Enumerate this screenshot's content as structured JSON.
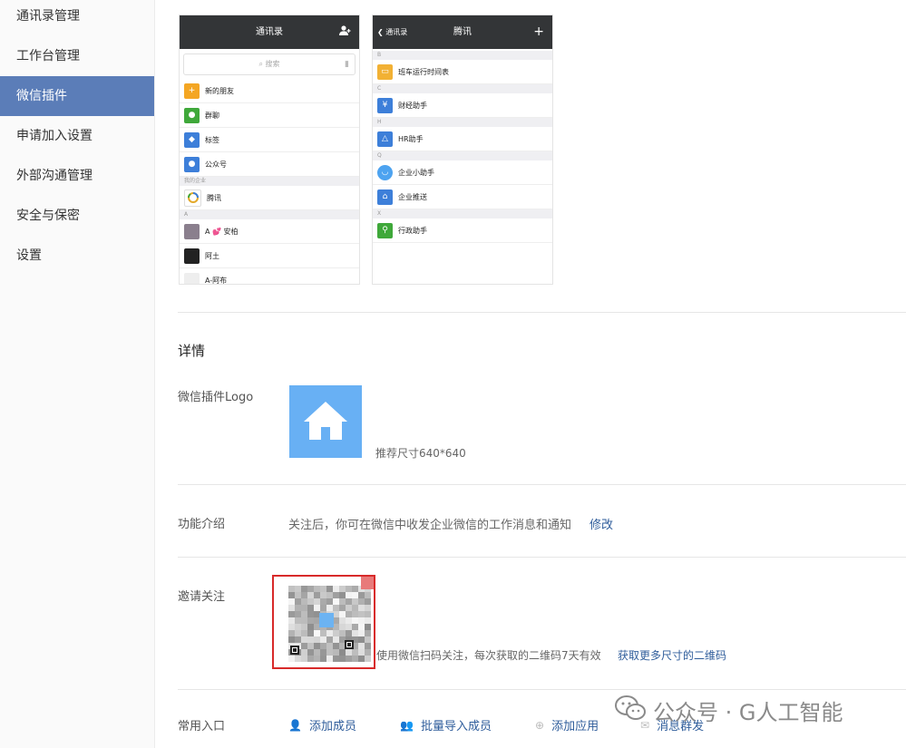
{
  "sidebar": {
    "items": [
      {
        "label": "通讯录管理"
      },
      {
        "label": "工作台管理"
      },
      {
        "label": "微信插件"
      },
      {
        "label": "申请加入设置"
      },
      {
        "label": "外部沟通管理"
      },
      {
        "label": "安全与保密"
      },
      {
        "label": "设置"
      }
    ]
  },
  "phone1": {
    "title": "通讯录",
    "search_placeholder": "搜索",
    "rows": [
      "新的朋友",
      "群聊",
      "标签",
      "公众号"
    ],
    "section_my_company": "我的企业",
    "company": "腾讯",
    "section_a": "A",
    "contacts": [
      "A 💕 安柏",
      "阿土",
      "A-阿布"
    ]
  },
  "phone2": {
    "back_label": "通讯录",
    "title": "腾讯",
    "section_b": "B",
    "section_c": "C",
    "section_h": "H",
    "section_q": "Q",
    "section_x": "X",
    "apps": [
      "班车运行时间表",
      "财经助手",
      "HR助手",
      "企业小助手",
      "企业推送",
      "行政助手"
    ]
  },
  "details": {
    "title": "详情",
    "logo_label": "微信插件Logo",
    "logo_hint": "推荐尺寸640*640",
    "intro_label": "功能介绍",
    "intro_text": "关注后，你可在微信中收发企业微信的工作消息和通知",
    "intro_edit": "修改",
    "invite_label": "邀请关注",
    "qr_hint": "使用微信扫码关注，每次获取的二维码7天有效",
    "qr_more": "获取更多尺寸的二维码"
  },
  "entries": {
    "label": "常用入口",
    "items": [
      "添加成员",
      "批量导入成员",
      "添加应用",
      "消息群发"
    ]
  },
  "watermark": {
    "text": "公众号 · G人工智能"
  },
  "colors": {
    "nav_active": "#5b7db8",
    "link": "#2f5d9b",
    "logo_bg": "#68b0f4",
    "phone_header": "#333537",
    "highlight_border": "#d82a2a"
  }
}
